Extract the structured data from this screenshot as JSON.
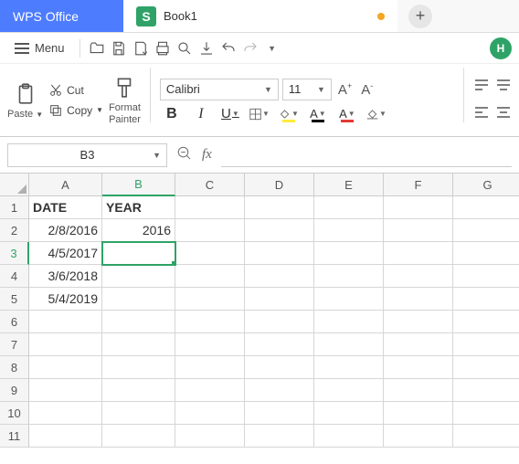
{
  "app_title": "WPS Office",
  "doc": {
    "icon_letter": "S",
    "name": "Book1"
  },
  "menu_label": "Menu",
  "clipboard": {
    "paste": "Paste",
    "cut": "Cut",
    "copy": "Copy",
    "painter_l1": "Format",
    "painter_l2": "Painter"
  },
  "font": {
    "name": "Calibri",
    "size": "11",
    "increase": "A",
    "decrease": "A",
    "bold": "B",
    "italic": "I",
    "underline": "U",
    "font_color_letter": "A",
    "highlight_letter": "A"
  },
  "namebox": "B3",
  "fx_label": "fx",
  "columns": [
    "A",
    "B",
    "C",
    "D",
    "E",
    "F",
    "G"
  ],
  "rows": [
    "1",
    "2",
    "3",
    "4",
    "5",
    "6",
    "7",
    "8",
    "9",
    "10",
    "11"
  ],
  "cells": {
    "A1": "DATE",
    "B1": "YEAR",
    "A2": "2/8/2016",
    "B2": "2016",
    "A3": "4/5/2017",
    "A4": "3/6/2018",
    "A5": "5/4/2019"
  },
  "active": {
    "col": "B",
    "row": "3"
  },
  "help_letter": "H"
}
